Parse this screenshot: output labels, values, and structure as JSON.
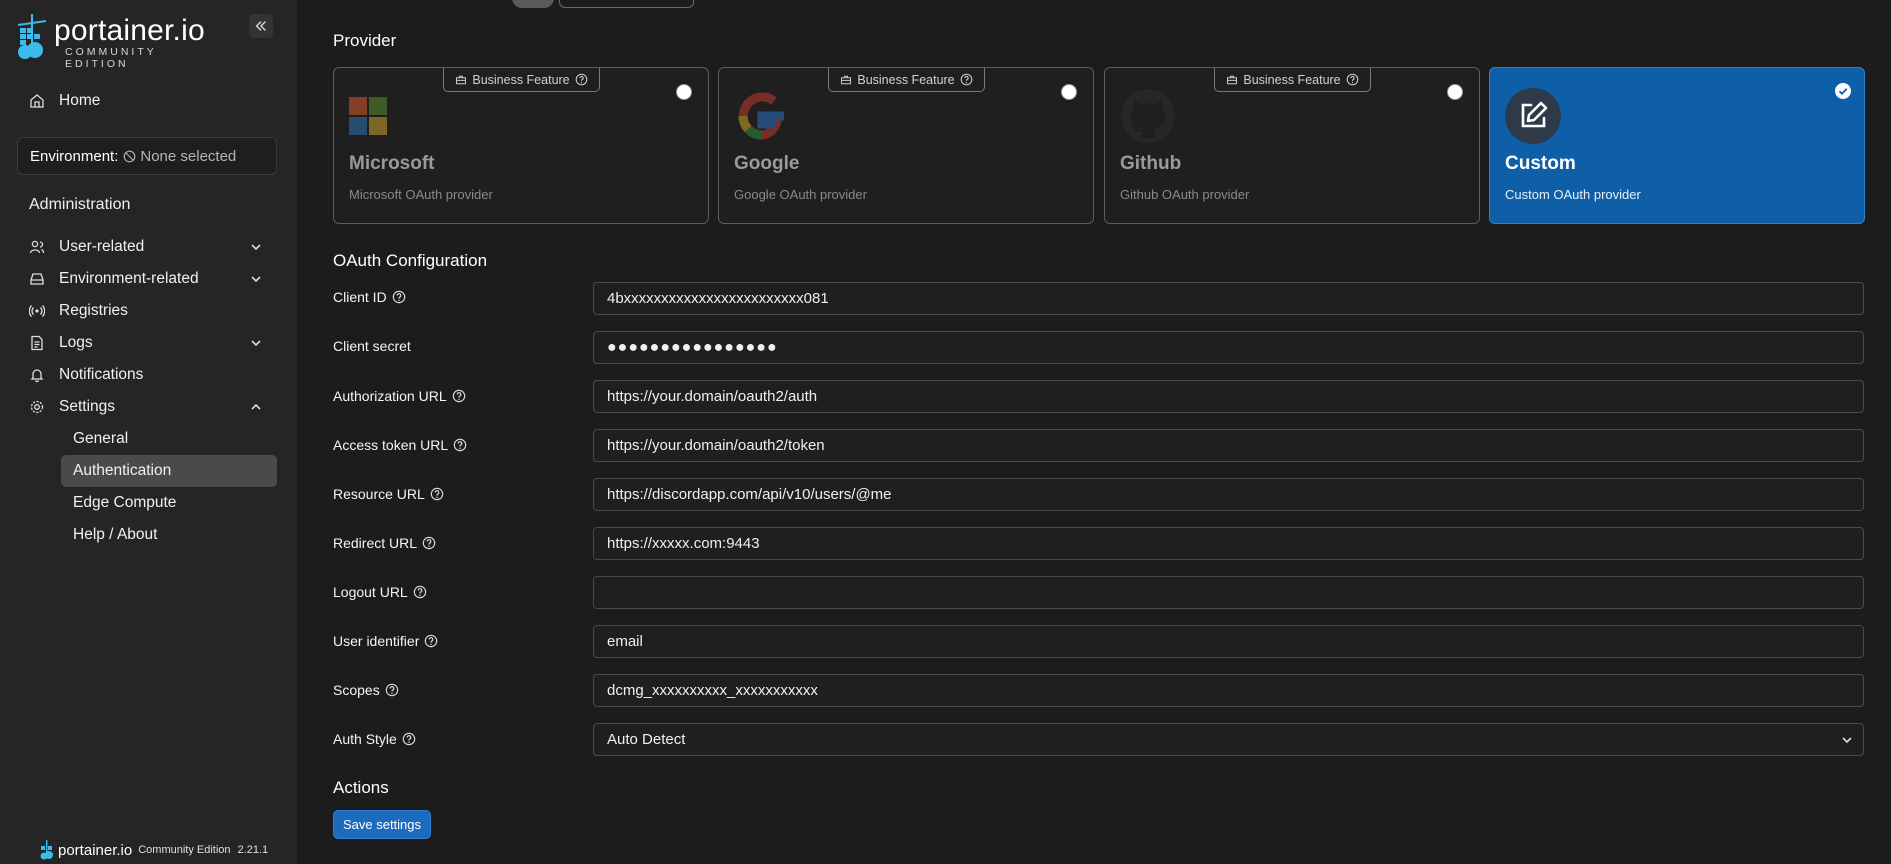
{
  "sidebar": {
    "logo_word": "portainer.io",
    "logo_sub": "COMMUNITY EDITION",
    "collapse_icon": "chevrons-left-icon",
    "home": "Home",
    "env_label": "Environment:",
    "env_value": "None selected",
    "admin_title": "Administration",
    "items": [
      {
        "label": "User-related",
        "icon": "users-icon",
        "chevron": "down"
      },
      {
        "label": "Environment-related",
        "icon": "server-icon",
        "chevron": "down"
      },
      {
        "label": "Registries",
        "icon": "radio-icon"
      },
      {
        "label": "Logs",
        "icon": "file-icon",
        "chevron": "down"
      },
      {
        "label": "Notifications",
        "icon": "bell-icon"
      },
      {
        "label": "Settings",
        "icon": "gear-icon",
        "chevron": "up"
      }
    ],
    "settings_sub": [
      "General",
      "Authentication",
      "Edge Compute",
      "Help / About"
    ],
    "footer_word": "portainer.io",
    "footer_edition": "Community Edition",
    "footer_version": "2.21.1"
  },
  "main": {
    "provider_title": "Provider",
    "business_badge": "Business Feature",
    "providers": [
      {
        "name": "Microsoft",
        "desc": "Microsoft OAuth provider",
        "state": "disabled"
      },
      {
        "name": "Google",
        "desc": "Google OAuth provider",
        "state": "disabled"
      },
      {
        "name": "Github",
        "desc": "Github OAuth provider",
        "state": "disabled"
      },
      {
        "name": "Custom",
        "desc": "Custom OAuth provider",
        "state": "selected"
      }
    ],
    "oauth_title": "OAuth Configuration",
    "fields": [
      {
        "label": "Client ID",
        "value": "4bxxxxxxxxxxxxxxxxxxxxxxxx081",
        "help": true
      },
      {
        "label": "Client secret",
        "value": "●●●●●●●●●●●●●●●●",
        "help": false
      },
      {
        "label": "Authorization URL",
        "value": "https://your.domain/oauth2/auth",
        "help": true
      },
      {
        "label": "Access token URL",
        "value": "https://your.domain/oauth2/token",
        "help": true
      },
      {
        "label": "Resource URL",
        "value": "https://discordapp.com/api/v10/users/@me",
        "help": true
      },
      {
        "label": "Redirect URL",
        "value": "https://xxxxx.com:9443",
        "help": true
      },
      {
        "label": "Logout URL",
        "value": "",
        "help": true
      },
      {
        "label": "User identifier",
        "value": "email",
        "help": true
      },
      {
        "label": "Scopes",
        "value": "dcmg_xxxxxxxxxx_xxxxxxxxxxx",
        "help": true
      },
      {
        "label": "Auth Style",
        "value": "Auto Detect",
        "help": true
      }
    ],
    "actions_title": "Actions",
    "save_label": "Save settings"
  },
  "colors": {
    "accent": "#1d6bbd",
    "selected_card": "#0f5ea8",
    "sidebar_bg": "#252525",
    "page_bg": "#1c1c1c"
  }
}
